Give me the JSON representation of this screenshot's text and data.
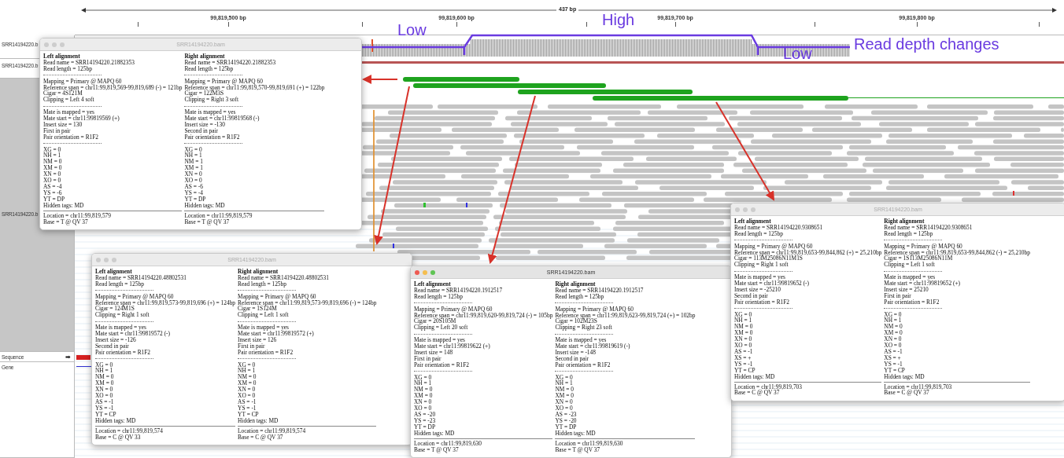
{
  "ruler": {
    "span": "437 bp",
    "ticks": [
      "99,819,500 bp",
      "99,819,600 bp",
      "99,819,700 bp",
      "99,819,800 bp"
    ]
  },
  "track_names": [
    "SRR14194220.b",
    "SRR14194220.b",
    "SRR14194220.b"
  ],
  "reference_tracks": [
    {
      "name": "Sequence",
      "arrow": "➡"
    },
    {
      "name": "Gene"
    }
  ],
  "depth_annotation": {
    "labels": [
      "Low",
      "High",
      "Low"
    ],
    "caption": "Read depth changes"
  },
  "popups": [
    {
      "title": "SRR14194220.bam",
      "active": false,
      "columns": [
        {
          "heading": "Left alignment",
          "sections": [
            [
              "Read name = SRR14194220.21882353",
              "Read length = 125bp"
            ],
            [
              "Mapping = Primary @ MAPQ 60",
              "Reference span = chr11:99,819,569-99,819,689 (-) = 121bp",
              "Cigar = 4S121M",
              "Clipping = Left 4 soft"
            ],
            [
              "Mate is mapped = yes",
              "Mate start = chr11:99819569 (+)",
              "Insert size = 130",
              "First in pair",
              "Pair orientation = R1F2"
            ],
            [
              "XG = 0",
              "NH = 1",
              "NM = 0",
              "XM = 0",
              "XN = 0",
              "XO = 0",
              "AS = -4",
              "YS = -6",
              "YT = DP",
              "Hidden tags: MD"
            ],
            [
              "Location = chr11:99,819,579",
              "Base = T @ QV 37"
            ]
          ]
        },
        {
          "heading": "Right alignment",
          "sections": [
            [
              "Read name = SRR14194220.21882353",
              "Read length = 125bp"
            ],
            [
              "Mapping = Primary @ MAPQ 60",
              "Reference span = chr11:99,819,570-99,819,691 (+) = 122bp",
              "Cigar = 122M3S",
              "Clipping = Right 3 soft"
            ],
            [
              "Mate is mapped = yes",
              "Mate start = chr11:99819568 (-)",
              "Insert size = -130",
              "Second in pair",
              "Pair orientation = R1F2"
            ],
            [
              "XG = 0",
              "NH = 1",
              "NM = 1",
              "XM = 1",
              "XN = 0",
              "XO = 0",
              "AS = -6",
              "YS = -4",
              "YT = DP",
              "Hidden tags: MD"
            ],
            [
              "Location = chr11:99,819,579",
              "Base = T @ QV 37"
            ]
          ]
        }
      ]
    },
    {
      "title": "SRR14194220.bam",
      "active": false,
      "columns": [
        {
          "heading": "Left alignment",
          "sections": [
            [
              "Read name = SRR14194220.48802531",
              "Read length = 125bp"
            ],
            [
              "Mapping = Primary @ MAPQ 60",
              "Reference span = chr11:99,819,573-99,819,696 (+) = 124bp",
              "Cigar = 124M1S",
              "Clipping = Right 1 soft"
            ],
            [
              "Mate is mapped = yes",
              "Mate start = chr11:99819572 (-)",
              "Insert size = -126",
              "Second in pair",
              "Pair orientation = R1F2"
            ],
            [
              "XG = 0",
              "NH = 1",
              "NM = 0",
              "XM = 0",
              "XN = 0",
              "XO = 0",
              "AS = -1",
              "YS = -1",
              "YT = CP",
              "Hidden tags: MD"
            ],
            [
              "Location = chr11:99,819,574",
              "Base = C @ QV 33"
            ]
          ]
        },
        {
          "heading": "Right alignment",
          "sections": [
            [
              "Read name = SRR14194220.48802531",
              "Read length = 125bp"
            ],
            [
              "Mapping = Primary @ MAPQ 60",
              "Reference span = chr11:99,819,573-99,819,696 (-) = 124bp",
              "Cigar = 1S124M",
              "Clipping = Left 1 soft"
            ],
            [
              "Mate is mapped = yes",
              "Mate start = chr11:99819572 (+)",
              "Insert size = 126",
              "First in pair",
              "Pair orientation = R1F2"
            ],
            [
              "XG = 0",
              "NH = 1",
              "NM = 0",
              "XM = 0",
              "XN = 0",
              "XO = 0",
              "AS = -1",
              "YS = -1",
              "YT = CP",
              "Hidden tags: MD"
            ],
            [
              "Location = chr11:99,819,574",
              "Base = C @ QV 37"
            ]
          ]
        }
      ]
    },
    {
      "title": "SRR14194220.bam",
      "active": true,
      "columns": [
        {
          "heading": "Left alignment",
          "sections": [
            [
              "Read name = SRR14194220.1912517",
              "Read length = 125bp"
            ],
            [
              "Mapping = Primary @ MAPQ 60",
              "Reference span = chr11:99,819,620-99,819,724 (-) = 105bp",
              "Cigar = 20S105M",
              "Clipping = Left 20 soft"
            ],
            [
              "Mate is mapped = yes",
              "Mate start = chr11:99819622 (+)",
              "Insert size = 148",
              "First in pair",
              "Pair orientation = R1F2"
            ],
            [
              "XG = 0",
              "NH = 1",
              "NM = 0",
              "XM = 0",
              "XN = 0",
              "XO = 0",
              "AS = -20",
              "YS = -23",
              "YT = DP",
              "Hidden tags: MD"
            ],
            [
              "Location = chr11:99,819,630",
              "Base = T @ QV 37"
            ]
          ]
        },
        {
          "heading": "Right alignment",
          "sections": [
            [
              "Read name = SRR14194220.1912517",
              "Read length = 125bp"
            ],
            [
              "Mapping = Primary @ MAPQ 60",
              "Reference span = chr11:99,819,623-99,819,724 (+) = 102bp",
              "Cigar = 102M23S",
              "Clipping = Right 23 soft"
            ],
            [
              "Mate is mapped = yes",
              "Mate start = chr11:99819619 (-)",
              "Insert size = -148",
              "Second in pair",
              "Pair orientation = R1F2"
            ],
            [
              "XG = 0",
              "NH = 1",
              "NM = 0",
              "XM = 0",
              "XN = 0",
              "XO = 0",
              "AS = -23",
              "YS = -20",
              "YT = DP",
              "Hidden tags: MD"
            ],
            [
              "Location = chr11:99,819,630",
              "Base = T @ QV 37"
            ]
          ]
        }
      ]
    },
    {
      "title": "SRR14194220.bam",
      "active": false,
      "columns": [
        {
          "heading": "Left alignment",
          "sections": [
            [
              "Read name = SRR14194220.9308651",
              "Read length = 125bp"
            ],
            [
              "Mapping = Primary @ MAPQ 60",
              "Reference span = chr11:99,819,653-99,844,862 (+) = 25,210bp",
              "Cigar = 113M25086N11M1S",
              "Clipping = Right 1 soft"
            ],
            [
              "Mate is mapped = yes",
              "Mate start = chr11:99819652 (-)",
              "Insert size = -25210",
              "Second in pair",
              "Pair orientation = R1F2"
            ],
            [
              "XG = 0",
              "NH = 1",
              "NM = 0",
              "XM = 0",
              "XN = 0",
              "XO = 0",
              "AS = -1",
              "XS = +",
              "YS = -1",
              "YT = CP",
              "Hidden tags: MD"
            ],
            [
              "Location = chr11:99,819,703",
              "Base = C @ QV 37"
            ]
          ]
        },
        {
          "heading": "Right alignment",
          "sections": [
            [
              "Read name = SRR14194220.9308651",
              "Read length = 125bp"
            ],
            [
              "Mapping = Primary @ MAPQ 60",
              "Reference span = chr11:99,819,653-99,844,862 (-) = 25,210bp",
              "Cigar = 1S113M25086N11M",
              "Clipping = Left 1 soft"
            ],
            [
              "Mate is mapped = yes",
              "Mate start = chr11:99819652 (+)",
              "Insert size = 25210",
              "First in pair",
              "Pair orientation = R1F2"
            ],
            [
              "XG = 0",
              "NH = 1",
              "NM = 0",
              "XM = 0",
              "XN = 0",
              "XO = 0",
              "AS = -1",
              "XS = +",
              "YS = -1",
              "YT = CP",
              "Hidden tags: MD"
            ],
            [
              "Location = chr11:99,819,703",
              "Base = C @ QV 37"
            ]
          ]
        }
      ]
    }
  ]
}
